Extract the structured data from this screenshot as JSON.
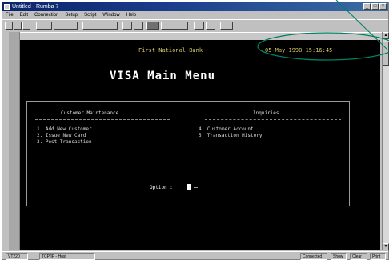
{
  "window": {
    "title": "Untitled - Rumba 7",
    "controls": [
      "_",
      "□",
      "×"
    ]
  },
  "menubar": {
    "items": [
      "File",
      "Edit",
      "Connection",
      "Setup",
      "Script",
      "Window",
      "Help"
    ]
  },
  "terminal": {
    "bank_name": "First National Bank",
    "datetime": "05-May-1998 15:16:45",
    "main_title": "VISA Main Menu",
    "left_section": {
      "heading": "Customer Maintenance",
      "items": [
        "1. Add New Customer",
        "2. Issue New Card",
        "3. Post Transaction"
      ]
    },
    "right_section": {
      "heading": "Inquiries",
      "items": [
        "4. Customer Account",
        "5. Transaction History"
      ]
    },
    "option_label": "Option :"
  },
  "statusbar": {
    "cells": [
      "VT220",
      "TCP/IP - Host",
      "Connected",
      "Show",
      "Clear",
      "Print"
    ]
  },
  "colors": {
    "terminal_bg": "#000000",
    "header_text": "#d4c864",
    "annotation": "#008060"
  }
}
